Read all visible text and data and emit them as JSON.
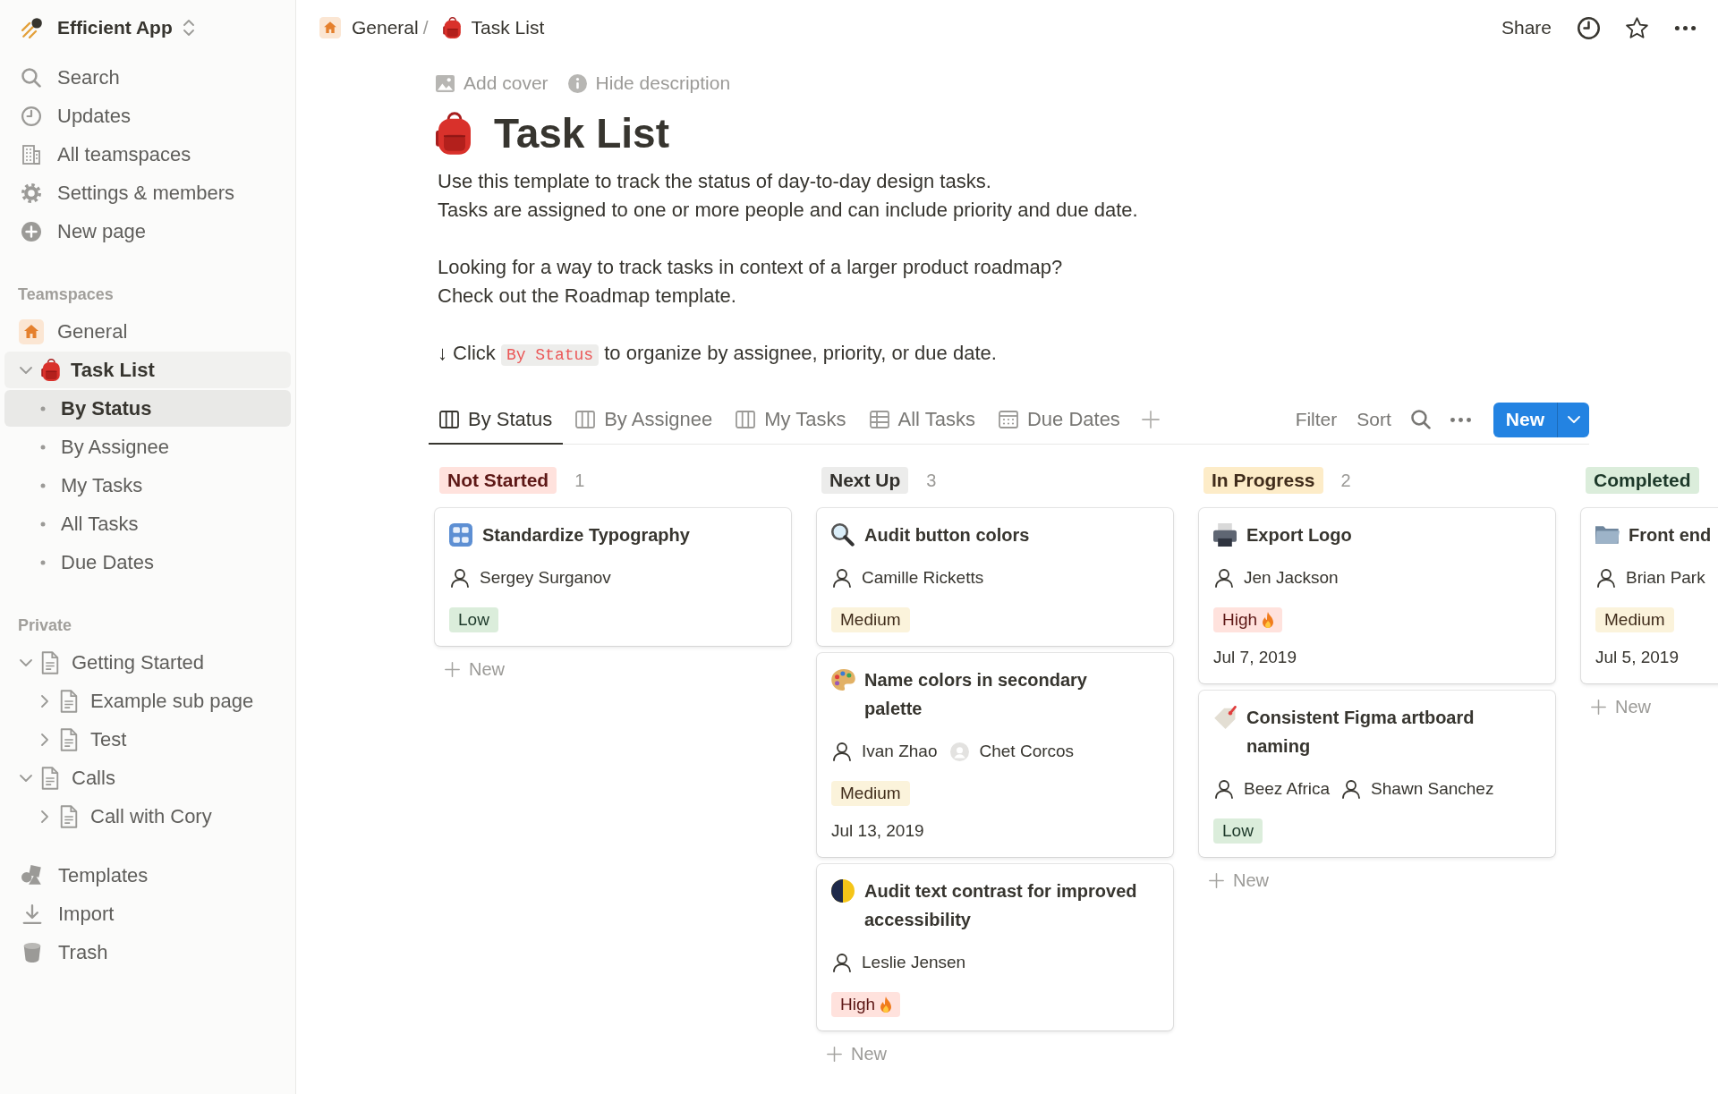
{
  "sidebar": {
    "workspace": "Efficient App",
    "nav": [
      {
        "label": "Search"
      },
      {
        "label": "Updates"
      },
      {
        "label": "All teamspaces"
      },
      {
        "label": "Settings & members"
      },
      {
        "label": "New page"
      }
    ],
    "sections": [
      {
        "title": "Teamspaces",
        "items": [
          {
            "label": "General",
            "kind": "teamspace",
            "selected": false
          },
          {
            "label": "Task List",
            "kind": "database",
            "selected": true,
            "expanded": true,
            "children": [
              {
                "label": "By Status",
                "kind": "view",
                "selected": true
              },
              {
                "label": "By Assignee",
                "kind": "view",
                "selected": false
              },
              {
                "label": "My Tasks",
                "kind": "view",
                "selected": false
              },
              {
                "label": "All Tasks",
                "kind": "view",
                "selected": false
              },
              {
                "label": "Due Dates",
                "kind": "view",
                "selected": false
              }
            ]
          }
        ]
      },
      {
        "title": "Private",
        "items": [
          {
            "label": "Getting Started",
            "kind": "page",
            "selected": false,
            "expanded": true,
            "children": [
              {
                "label": "Example sub page",
                "kind": "page",
                "selected": false,
                "expanded": false
              },
              {
                "label": "Test",
                "kind": "page",
                "selected": false,
                "expanded": false
              }
            ]
          },
          {
            "label": "Calls",
            "kind": "page",
            "selected": false,
            "expanded": true,
            "children": [
              {
                "label": "Call with Cory",
                "kind": "page",
                "selected": false,
                "expanded": false
              }
            ]
          }
        ]
      }
    ],
    "footer": [
      {
        "label": "Templates"
      },
      {
        "label": "Import"
      },
      {
        "label": "Trash"
      }
    ]
  },
  "topbar": {
    "breadcrumb": [
      {
        "label": "General",
        "kind": "teamspace"
      },
      {
        "label": "Task List",
        "kind": "database"
      }
    ],
    "separator": "/",
    "share": "Share"
  },
  "page": {
    "actions": [
      {
        "label": "Add cover"
      },
      {
        "label": "Hide description"
      }
    ],
    "title": "Task List",
    "description": [
      {
        "lines": [
          "Use this template to track the status of day-to-day design tasks.",
          "Tasks are assigned to one or more people and can include priority and due date."
        ]
      },
      {
        "lines": [
          "Looking for a way to track tasks in context of a larger product roadmap?",
          "Check out the Roadmap template."
        ]
      }
    ],
    "hint": {
      "text_before": "↓ Click",
      "code": "By Status",
      "text_after": "to organize by assignee, priority, or due date."
    }
  },
  "views": {
    "tabs": [
      {
        "label": "By Status",
        "kind": "board",
        "selected": true
      },
      {
        "label": "By Assignee",
        "kind": "board",
        "selected": false
      },
      {
        "label": "My Tasks",
        "kind": "board",
        "selected": false
      },
      {
        "label": "All Tasks",
        "kind": "table",
        "selected": false
      },
      {
        "label": "Due Dates",
        "kind": "calendar",
        "selected": false
      }
    ],
    "filter": "Filter",
    "sort": "Sort",
    "new_button": "New"
  },
  "board": {
    "columns": [
      {
        "label": "Not Started",
        "color": "#ffe2dd",
        "count": "1",
        "add_label": "New",
        "cards": [
          {
            "title": "Standardize Typography",
            "people": [
              {
                "name": "Sergey Surganov",
                "default_avatar": false
              }
            ],
            "tag": {
              "label": "Low",
              "color": "#dbeddb",
              "flame": false
            }
          }
        ]
      },
      {
        "label": "Next Up",
        "color": "#ececeb",
        "count": "3",
        "add_label": "New",
        "cards": [
          {
            "title": "Audit button colors",
            "people": [
              {
                "name": "Camille Ricketts",
                "default_avatar": false
              }
            ],
            "tag": {
              "label": "Medium",
              "color": "#fbf3db",
              "flame": false
            }
          },
          {
            "title": "Name colors in secondary palette",
            "people": [
              {
                "name": "Ivan Zhao",
                "default_avatar": false
              },
              {
                "name": "Chet Corcos",
                "default_avatar": true
              }
            ],
            "tag": {
              "label": "Medium",
              "color": "#fbf3db",
              "flame": false
            },
            "date": "Jul 13, 2019"
          },
          {
            "title": "Audit text contrast for improved accessibility",
            "people": [
              {
                "name": "Leslie Jensen",
                "default_avatar": false
              }
            ],
            "tag": {
              "label": "High",
              "color": "#ffe2dd",
              "flame": true
            }
          }
        ]
      },
      {
        "label": "In Progress",
        "color": "#fdecc8",
        "count": "2",
        "add_label": "New",
        "cards": [
          {
            "title": "Export Logo",
            "people": [
              {
                "name": "Jen Jackson",
                "default_avatar": false
              }
            ],
            "tag": {
              "label": "High",
              "color": "#ffe2dd",
              "flame": true
            },
            "date": "Jul 7, 2019"
          },
          {
            "title": "Consistent Figma artboard naming",
            "people": [
              {
                "name": "Beez Africa",
                "default_avatar": false
              },
              {
                "name": "Shawn Sanchez",
                "default_avatar": false
              }
            ],
            "tag": {
              "label": "Low",
              "color": "#dbeddb",
              "flame": false
            }
          }
        ]
      },
      {
        "label": "Completed",
        "color": "#dbeddb",
        "add_label": "New",
        "cards": [
          {
            "title": "Front end",
            "people": [
              {
                "name": "Brian Park",
                "default_avatar": false
              }
            ],
            "tag": {
              "label": "Medium",
              "color": "#fbf3db",
              "flame": false
            },
            "date": "Jul 5, 2019"
          }
        ]
      }
    ]
  }
}
